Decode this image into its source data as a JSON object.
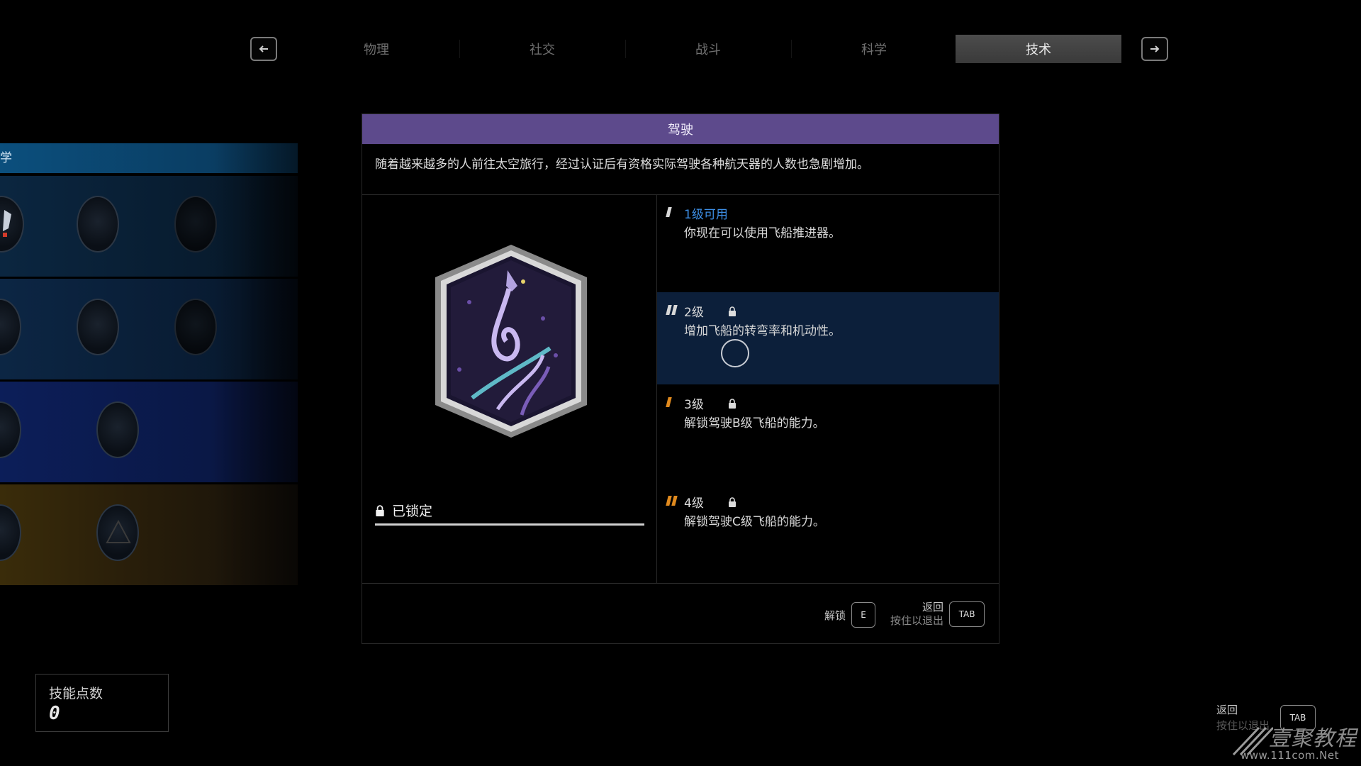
{
  "tabs": {
    "prev_icon": "arrow-left-icon",
    "next_icon": "arrow-right-icon",
    "items": [
      {
        "label": "物理",
        "active": false
      },
      {
        "label": "社交",
        "active": false
      },
      {
        "label": "战斗",
        "active": false
      },
      {
        "label": "科学",
        "active": false
      },
      {
        "label": "技术",
        "active": true
      }
    ]
  },
  "category": {
    "header_label": "学",
    "header_color": "#0b4f7d"
  },
  "skill": {
    "title": "驾驶",
    "title_color": "#5d4a8c",
    "description": "随着越来越多的人前往太空旅行，经过认证后有资格实际驾驶各种航天器的人数也急剧增加。",
    "status": "已锁定",
    "ranks": [
      {
        "label": "1级可用",
        "desc": "你现在可以使用飞船推进器。",
        "locked": false,
        "selected": false,
        "bars": 1,
        "color": "#d8d8d8"
      },
      {
        "label": "2级",
        "desc": "增加飞船的转弯率和机动性。",
        "locked": true,
        "selected": true,
        "bars": 2,
        "color": "#d8d8d8"
      },
      {
        "label": "3级",
        "desc": "解锁驾驶B级飞船的能力。",
        "locked": true,
        "selected": false,
        "bars": 1,
        "color": "#e08a1e"
      },
      {
        "label": "4级",
        "desc": "解锁驾驶C级飞船的能力。",
        "locked": true,
        "selected": false,
        "bars": 2,
        "color": "#e08a1e"
      }
    ]
  },
  "actions": {
    "unlock_label": "解锁",
    "unlock_key": "E",
    "back_label": "返回",
    "back_sub": "按住以退出",
    "back_key": "TAB"
  },
  "skill_points": {
    "label": "技能点数",
    "value": "0"
  },
  "bottom_right": {
    "back_label": "返回",
    "back_sub": "按住以退出",
    "key": "TAB"
  },
  "watermark": {
    "logo_text": "壹聚教程",
    "url": "www.111com.Net"
  }
}
